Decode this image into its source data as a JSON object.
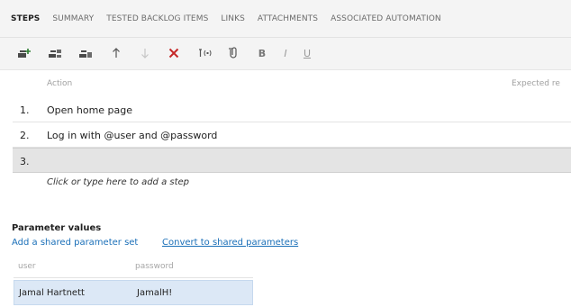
{
  "tabs": [
    {
      "label": "STEPS",
      "active": true
    },
    {
      "label": "SUMMARY",
      "active": false
    },
    {
      "label": "TESTED BACKLOG ITEMS",
      "active": false
    },
    {
      "label": "LINKS",
      "active": false
    },
    {
      "label": "ATTACHMENTS",
      "active": false
    },
    {
      "label": "ASSOCIATED AUTOMATION",
      "active": false
    }
  ],
  "toolbar": {
    "icons": [
      "insert-step-icon",
      "insert-shared-steps-icon",
      "create-shared-steps-icon",
      "move-up-icon",
      "move-down-icon",
      "delete-step-icon",
      "insert-parameter-icon",
      "attachment-icon",
      "bold-icon",
      "italic-icon",
      "underline-icon"
    ],
    "bold_label": "B",
    "italic_label": "I",
    "underline_label": "U"
  },
  "steps": {
    "column_action": "Action",
    "column_expected": "Expected re",
    "rows": [
      {
        "num": "1.",
        "action": "Open home page"
      },
      {
        "num": "2.",
        "action": "Log in with  @user and  @password"
      },
      {
        "num": "3.",
        "action": ""
      }
    ],
    "add_step_hint": "Click or type here to add a step"
  },
  "parameters": {
    "title": "Parameter values",
    "add_shared_set": "Add a shared parameter set",
    "convert_shared": "Convert to shared parameters",
    "columns": [
      "user",
      "password"
    ],
    "rows": [
      {
        "user": "Jamal Hartnett",
        "password": "JamalH!"
      }
    ]
  },
  "colors": {
    "accent": "#1a6fb8",
    "selected_row": "#e4e4e4",
    "param_selected": "#dce8f6"
  }
}
